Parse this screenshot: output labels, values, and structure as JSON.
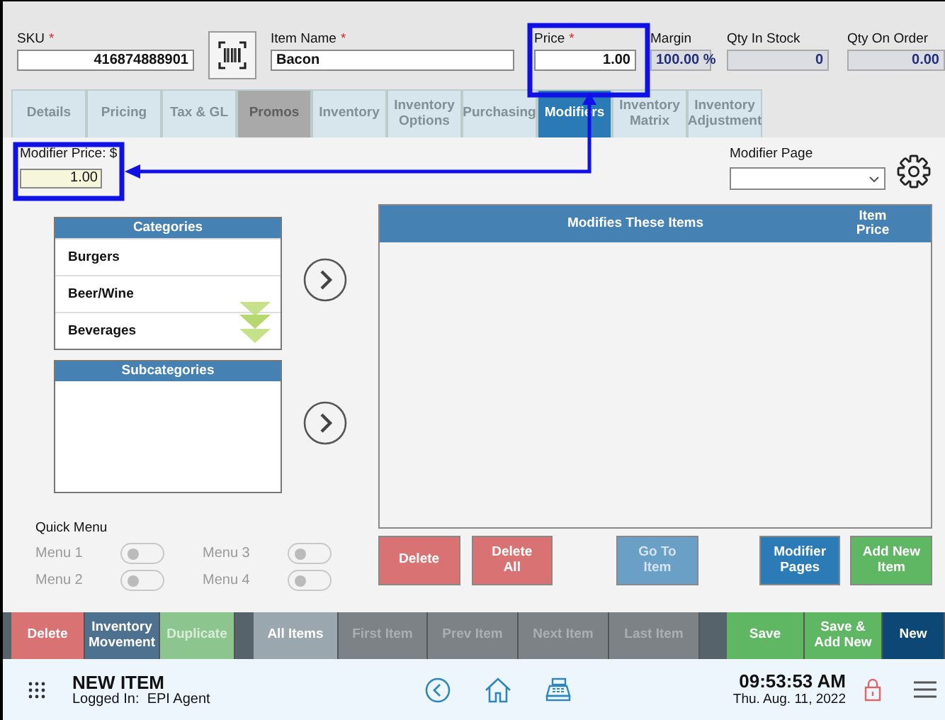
{
  "header": {
    "fields": [
      {
        "label": "SKU",
        "required_mark": "*",
        "value": "416874888901",
        "kind": "input"
      },
      {
        "label": "Item Name",
        "required_mark": "*",
        "value": "Bacon",
        "kind": "input"
      },
      {
        "label": "Price",
        "required_mark": "*",
        "value": "1.00",
        "kind": "input"
      },
      {
        "label": "Margin",
        "value": "100.00 %",
        "kind": "readonly"
      },
      {
        "label": "Qty In Stock",
        "value": "0",
        "kind": "readonly"
      },
      {
        "label": "Qty On Order",
        "value": "0.00",
        "kind": "readonly"
      }
    ]
  },
  "tabs": [
    {
      "label": "Details",
      "selected": false,
      "disabled": false
    },
    {
      "label": "Pricing",
      "selected": false,
      "disabled": false
    },
    {
      "label": "Tax & GL",
      "selected": false,
      "disabled": false
    },
    {
      "label": "Promos",
      "selected": false,
      "disabled": true
    },
    {
      "label": "Inventory",
      "selected": false,
      "disabled": false
    },
    {
      "label": "Inventory\nOptions",
      "selected": false,
      "disabled": false
    },
    {
      "label": "Purchasing",
      "selected": false,
      "disabled": false
    },
    {
      "label": "Modifiers",
      "selected": true,
      "disabled": false
    },
    {
      "label": "Inventory\nMatrix",
      "selected": false,
      "disabled": false
    },
    {
      "label": "Inventory\nAdjustment",
      "selected": false,
      "disabled": false
    }
  ],
  "modifier_price": {
    "label": "Modifier Price: $",
    "value": "1.00"
  },
  "modifier_page": {
    "label": "Modifier Page"
  },
  "categories": {
    "title": "Categories",
    "items": [
      "Burgers",
      "Beer/Wine",
      "Beverages"
    ]
  },
  "subcategories": {
    "title": "Subcategories"
  },
  "quick_menu": {
    "title": "Quick Menu",
    "toggles": [
      {
        "label": "Menu 1",
        "on": false,
        "disabled": true
      },
      {
        "label": "Menu 3",
        "on": false,
        "disabled": true
      },
      {
        "label": "Menu 2",
        "on": false,
        "disabled": true
      },
      {
        "label": "Menu 4",
        "on": false,
        "disabled": true
      }
    ]
  },
  "modifies_table": {
    "columns": [
      "Modifies These Items",
      "Item Price"
    ]
  },
  "action_buttons": [
    {
      "label": "Delete",
      "color": "#d97373",
      "disabled": false
    },
    {
      "label": "Delete\nAll",
      "color": "#d97373",
      "disabled": false
    },
    {
      "label": "Go To\nItem",
      "color": "#6aa0c6",
      "disabled": true
    },
    {
      "label": "Modifier\nPages",
      "color": "#2b7bb7",
      "disabled": false
    },
    {
      "label": "Add New\nItem",
      "color": "#5fb663",
      "disabled": false
    }
  ],
  "bottom_bar": [
    [
      {
        "label": "Delete",
        "color": "#d97373",
        "disabled": false
      },
      {
        "label": "Inventory\nMovement",
        "color": "#4f7190",
        "disabled": false
      },
      {
        "label": "Duplicate",
        "color": "#8dc58f",
        "disabled": true
      }
    ],
    [
      {
        "label": "All Items",
        "color": "#9ba7ae",
        "disabled": false
      },
      {
        "label": "First Item",
        "color": "#7c8286",
        "disabled": true
      },
      {
        "label": "Prev Item",
        "color": "#7c8286",
        "disabled": true
      },
      {
        "label": "Next Item",
        "color": "#7c8286",
        "disabled": true
      },
      {
        "label": "Last Item",
        "color": "#7c8286",
        "disabled": true
      }
    ],
    [
      {
        "label": "Save",
        "color": "#5fb663",
        "disabled": false
      },
      {
        "label": "Save &\nAdd New",
        "color": "#5fb663",
        "disabled": false
      },
      {
        "label": "New",
        "color": "#0d4775",
        "disabled": false
      }
    ]
  ],
  "footer": {
    "title": "NEW ITEM",
    "login": "Logged In:  EPI Agent",
    "time": "09:53:53 AM",
    "date": "Thu. Aug. 11, 2022"
  }
}
